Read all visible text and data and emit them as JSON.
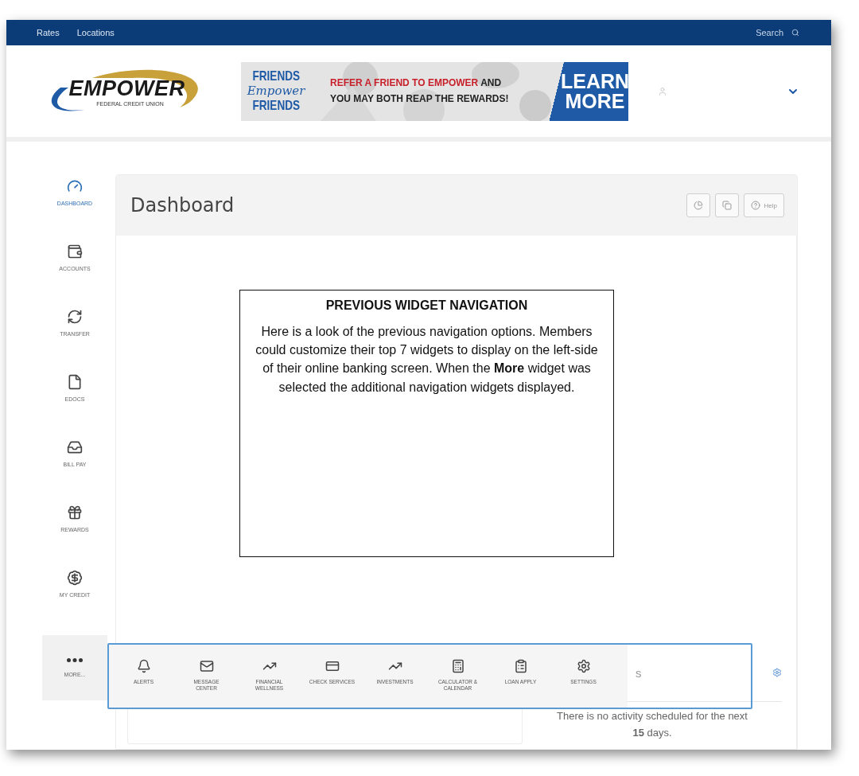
{
  "topbar": {
    "links": [
      "Rates",
      "Locations"
    ],
    "search": "Search"
  },
  "logo": {
    "name": "EMPOWER",
    "tagline": "FEDERAL CREDIT UNION"
  },
  "banner": {
    "left": [
      "FRIENDS",
      "Empower",
      "FRIENDS"
    ],
    "message_red": "REFER A FRIEND TO EMPOWER",
    "message_dark": "AND",
    "message_line2": "YOU MAY BOTH REAP THE REWARDS!",
    "cta": "LEARN MORE"
  },
  "sidebar": {
    "items": [
      {
        "label": "DASHBOARD",
        "selected": true
      },
      {
        "label": "ACCOUNTS",
        "selected": false
      },
      {
        "label": "TRANSFER",
        "selected": false
      },
      {
        "label": "EDOCS",
        "selected": false
      },
      {
        "label": "BILL PAY",
        "selected": false
      },
      {
        "label": "REWARDS",
        "selected": false
      },
      {
        "label": "MY CREDIT",
        "selected": false
      }
    ],
    "more": {
      "label": "MORE...",
      "selected": true
    }
  },
  "dashboard": {
    "title": "Dashboard",
    "help": "Help"
  },
  "more_menu": [
    "ALERTS",
    "MESSAGE CENTER",
    "FINANCIAL WELLNESS",
    "CHECK SERVICES",
    "INVESTMENTS",
    "CALCULATOR & CALENDAR",
    "LOAN APPLY",
    "SETTINGS"
  ],
  "activity": {
    "heading_fragment": "s",
    "message": "There is no activity scheduled for the next **15** days."
  },
  "annotation": {
    "title": "PREVIOUS WIDGET NAVIGATION",
    "body": "Here is a look of the previous navigation options. Members could customize their top 7 widgets to display on the left-side of their online banking screen.  When the **More** widget was selected the additional navigation widgets displayed."
  }
}
